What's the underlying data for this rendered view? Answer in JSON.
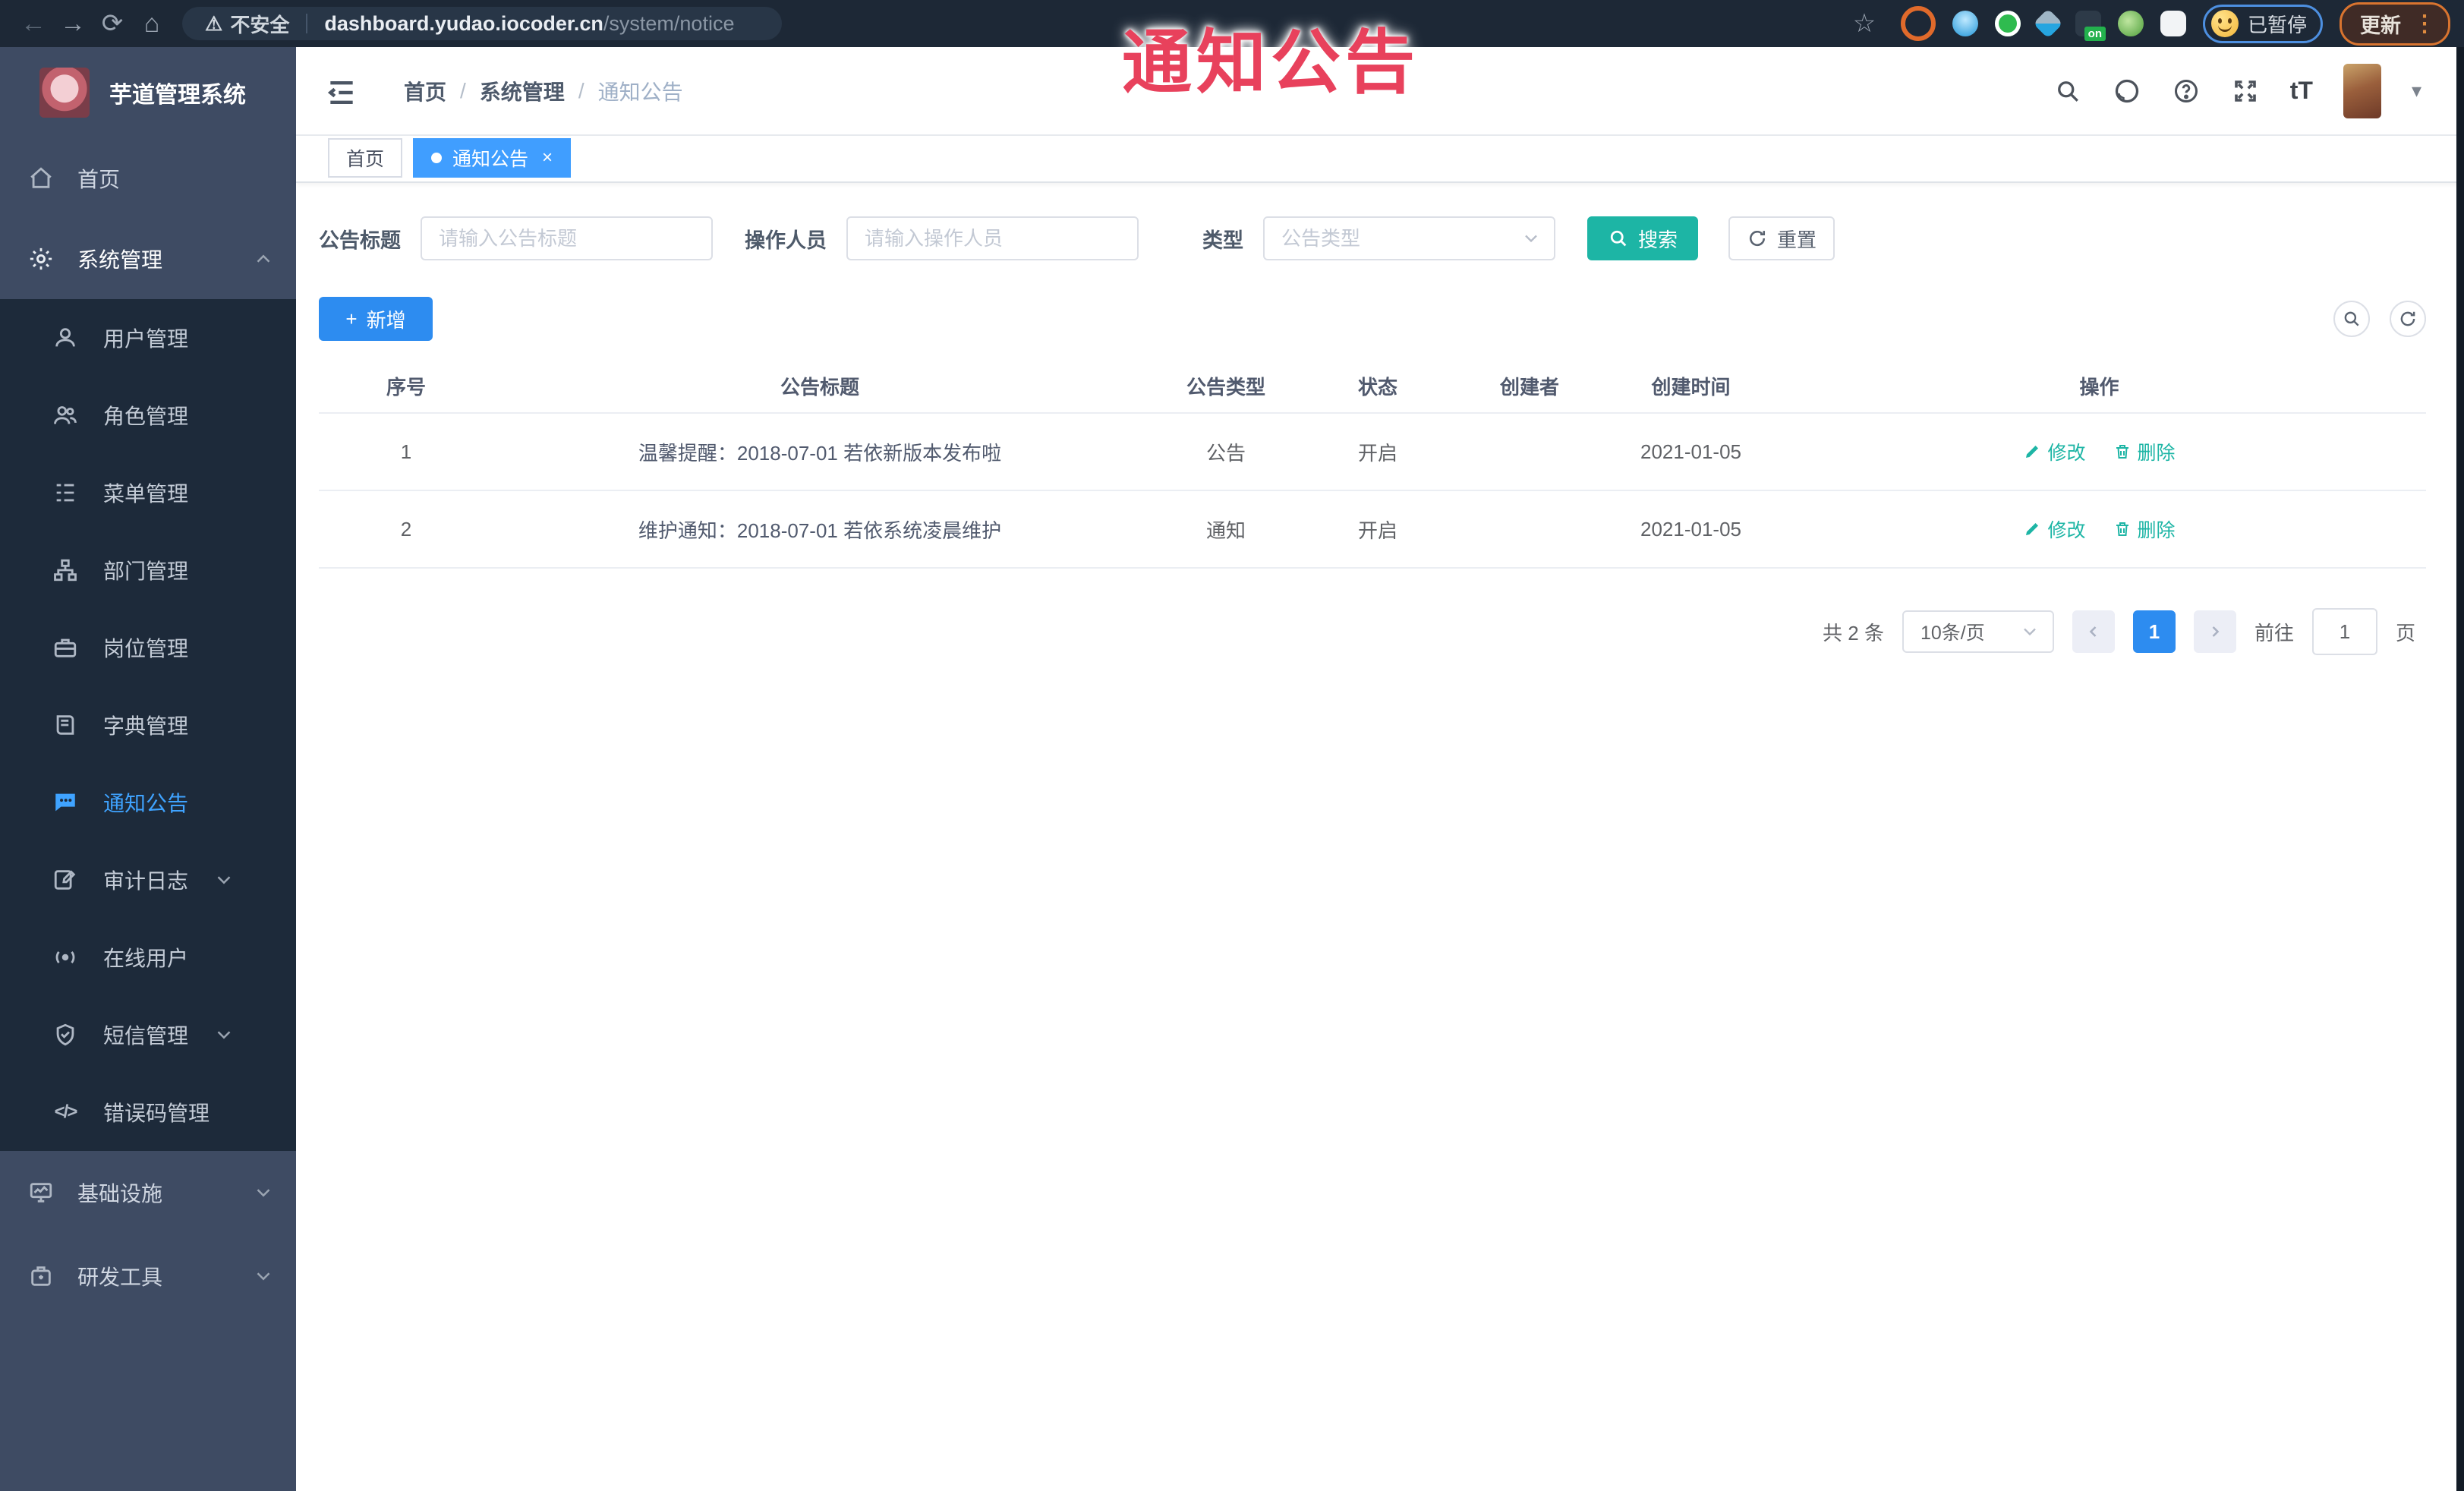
{
  "annotation": {
    "text": "通知公告"
  },
  "browser": {
    "security_warning": "不安全",
    "url_host": "dashboard.yudao.iocoder.cn",
    "url_path": "/system/notice",
    "extension_badge": "on",
    "paused_label": "已暂停",
    "update_label": "更新"
  },
  "icons": {
    "back": "←",
    "forward": "→",
    "reload": "⟳",
    "home": "⌂",
    "warning": "⚠",
    "star": "☆",
    "kebab": "⋮",
    "caret": "▾",
    "font_size": "tT",
    "code": "</>",
    "plus": "+",
    "close": "×"
  },
  "sidebar": {
    "title": "芋道管理系统",
    "items": [
      {
        "label": "首页"
      },
      {
        "label": "系统管理"
      },
      {
        "label": "用户管理"
      },
      {
        "label": "角色管理"
      },
      {
        "label": "菜单管理"
      },
      {
        "label": "部门管理"
      },
      {
        "label": "岗位管理"
      },
      {
        "label": "字典管理"
      },
      {
        "label": "通知公告"
      },
      {
        "label": "审计日志"
      },
      {
        "label": "在线用户"
      },
      {
        "label": "短信管理"
      },
      {
        "label": "错误码管理"
      },
      {
        "label": "基础设施"
      },
      {
        "label": "研发工具"
      }
    ]
  },
  "header": {
    "breadcrumb": {
      "home": "首页",
      "section": "系统管理",
      "current": "通知公告"
    }
  },
  "tabs": [
    {
      "label": "首页"
    },
    {
      "label": "通知公告"
    }
  ],
  "filters": {
    "title_label": "公告标题",
    "title_placeholder": "请输入公告标题",
    "operator_label": "操作人员",
    "operator_placeholder": "请输入操作人员",
    "type_label": "类型",
    "type_placeholder": "公告类型",
    "search_label": "搜索",
    "reset_label": "重置"
  },
  "toolbar": {
    "add_label": "新增"
  },
  "table": {
    "columns": [
      "序号",
      "公告标题",
      "公告类型",
      "状态",
      "创建者",
      "创建时间",
      "操作"
    ],
    "rows": [
      {
        "no": "1",
        "title": "温馨提醒：2018-07-01 若依新版本发布啦",
        "type": "公告",
        "status": "开启",
        "creator": "",
        "created": "2021-01-05",
        "edit": "修改",
        "delete": "删除"
      },
      {
        "no": "2",
        "title": "维护通知：2018-07-01 若依系统凌晨维护",
        "type": "通知",
        "status": "开启",
        "creator": "",
        "created": "2021-01-05",
        "edit": "修改",
        "delete": "删除"
      }
    ]
  },
  "pagination": {
    "total": "共 2 条",
    "page_size": "10条/页",
    "current_page": "1",
    "goto_label": "前往",
    "goto_value": "1",
    "page_suffix": "页"
  },
  "colors": {
    "primary_blue": "#409eff",
    "action_teal": "#1db5a5",
    "annotation_red": "#e8415c",
    "sidebar_bg": "#3e4b63",
    "submenu_bg": "#1d2a3a",
    "browser_bar_bg": "#1d2836"
  }
}
